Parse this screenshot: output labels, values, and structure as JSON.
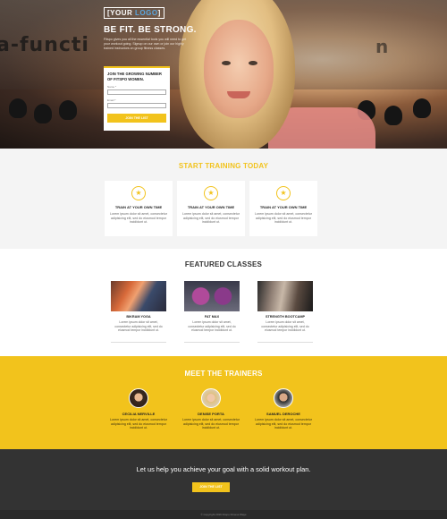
{
  "brand": {
    "logo_part1": "YOUR",
    "logo_part2": "LOGO",
    "accent": "#f2c31c",
    "logo_accent": "#5aa7e0"
  },
  "hero": {
    "title": "BE FIT. BE STRONG.",
    "text": "Fitspo gives you all the essential tools you will need to get your workout going. Signup on our own or join our highly trained instructors on group fitness classes.",
    "background_words": [
      "a-functi",
      "n"
    ]
  },
  "signup": {
    "heading": "JOIN THE GROWING NUMBER OF FITSPO WOMEN.",
    "name_label": "Name *",
    "email_label": "Email *",
    "name_value": "",
    "email_value": "",
    "button": "JOIN THE LIST"
  },
  "training": {
    "title": "START TRAINING TODAY",
    "icon": "star-icon",
    "cards": [
      {
        "title": "TRAIN AT YOUR OWN TIME",
        "text": "Lorem ipsum dolor sit amet, consectetur adipisicing elit, sed do eiusmod tempor incididunt ut."
      },
      {
        "title": "TRAIN AT YOUR OWN TIME",
        "text": "Lorem ipsum dolor sit amet, consectetur adipisicing elit, sed do eiusmod tempor incididunt ut."
      },
      {
        "title": "TRAIN AT YOUR OWN TIME",
        "text": "Lorem ipsum dolor sit amet, consectetur adipisicing elit, sed do eiusmod tempor incididunt ut."
      }
    ]
  },
  "featured": {
    "title": "FEATURED CLASSES",
    "classes": [
      {
        "name": "BIKRAM YOGA",
        "text": "Lorem ipsum dolor sit amet, consectetur adipisicing elit, sed do eiusmod tempor incididunt ut."
      },
      {
        "name": "FAT MAX",
        "text": "Lorem ipsum dolor sit amet, consectetur adipisicing elit, sed do eiusmod tempor incididunt ut."
      },
      {
        "name": "STRENGTH BOOTCAMP",
        "text": "Lorem ipsum dolor sit amet, consectetur adipisicing elit, sed do eiusmod tempor incididunt ut."
      }
    ]
  },
  "trainers": {
    "title": "MEET THE TRAINERS",
    "people": [
      {
        "name": "CECILIA NERVILLE",
        "text": "Lorem ipsum dolor sit amet, consectetur adipisicing elit, sed do eiusmod tempor incididunt ut."
      },
      {
        "name": "DENISE PORTA",
        "text": "Lorem ipsum dolor sit amet, consectetur adipisicing elit, sed do eiusmod tempor incididunt ut."
      },
      {
        "name": "SAMUEL DEROCHE",
        "text": "Lorem ipsum dolor sit amet, consectetur adipisicing elit, sed do eiusmod tempor incididunt ut."
      }
    ]
  },
  "cta": {
    "text": "Let us help you achieve your goal with a solid workout plan.",
    "button": "JOIN THE LIST"
  },
  "footer": {
    "text": "© Copyright 2016 Fitspo Fitness Ways"
  }
}
